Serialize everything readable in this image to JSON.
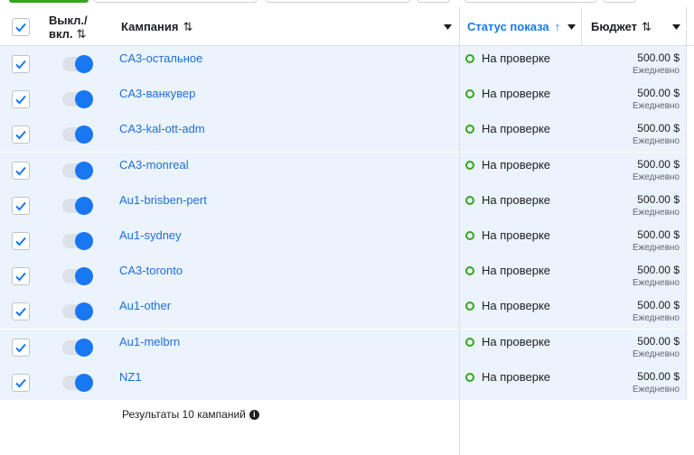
{
  "header": {
    "toggle_col": "Выкл./",
    "toggle_col2": "вкл.",
    "sort_icon": "⇅",
    "campaign_col": "Кампания",
    "status_col": "Статус показа",
    "budget_col": "Бюджет"
  },
  "rows": [
    {
      "name": "CA3-остальное",
      "status": "На проверке",
      "budget": "500.00 $",
      "period": "Ежедневно"
    },
    {
      "name": "CA3-ванкувер",
      "status": "На проверке",
      "budget": "500.00 $",
      "period": "Ежедневно"
    },
    {
      "name": "CA3-kal-ott-adm",
      "status": "На проверке",
      "budget": "500.00 $",
      "period": "Ежедневно"
    },
    {
      "name": "CA3-monreal",
      "status": "На проверке",
      "budget": "500.00 $",
      "period": "Ежедневно"
    },
    {
      "name": "Au1-brisben-pert",
      "status": "На проверке",
      "budget": "500.00 $",
      "period": "Ежедневно"
    },
    {
      "name": "Au1-sydney",
      "status": "На проверке",
      "budget": "500.00 $",
      "period": "Ежедневно"
    },
    {
      "name": "CA3-toronto",
      "status": "На проверке",
      "budget": "500.00 $",
      "period": "Ежедневно"
    },
    {
      "name": "Au1-other",
      "status": "На проверке",
      "budget": "500.00 $",
      "period": "Ежедневно"
    },
    {
      "name": "Au1-melbrn",
      "status": "На проверке",
      "budget": "500.00 $",
      "period": "Ежедневно"
    },
    {
      "name": "NZ1",
      "status": "На проверке",
      "budget": "500.00 $",
      "period": "Ежедневно"
    }
  ],
  "footer": {
    "results": "Результаты 10 кампаний",
    "info_icon": "i"
  },
  "colors": {
    "accent": "#1877f2",
    "selected_row": "#ebf3fc",
    "status_green": "#36a420",
    "link": "#216fdb"
  }
}
